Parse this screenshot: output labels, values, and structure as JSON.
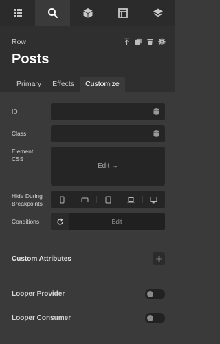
{
  "topbar": {
    "tabs": [
      {
        "icon": "list-icon",
        "active": false
      },
      {
        "icon": "search-icon",
        "active": true
      },
      {
        "icon": "box-icon",
        "active": false
      },
      {
        "icon": "layout-icon",
        "active": false
      },
      {
        "icon": "layers-icon",
        "active": false
      }
    ]
  },
  "header": {
    "breadcrumb": "Row",
    "title": "Posts",
    "icons": [
      "move-up-icon",
      "duplicate-icon",
      "delete-icon",
      "settings-icon"
    ]
  },
  "tabs": [
    {
      "label": "Primary",
      "active": false
    },
    {
      "label": "Effects",
      "active": false
    },
    {
      "label": "Customize",
      "active": true
    }
  ],
  "fields": {
    "id_label": "ID",
    "id_value": "",
    "class_label": "Class",
    "class_value": "",
    "element_css_label": "Element\nCSS",
    "element_css_button": "Edit →",
    "hide_label": "Hide During\nBreakpoints",
    "breakpoints": [
      "mobile-portrait-icon",
      "mobile-landscape-icon",
      "tablet-icon",
      "laptop-icon",
      "desktop-icon"
    ],
    "conditions_label": "Conditions",
    "conditions_button": "Edit"
  },
  "sections": {
    "custom_attributes": "Custom Attributes",
    "looper_provider": "Looper Provider",
    "looper_consumer": "Looper Consumer"
  },
  "toggles": {
    "looper_provider": false,
    "looper_consumer": false
  },
  "colors": {
    "background": "#3a3a3a",
    "header": "#2f2f2f",
    "field": "#252525"
  }
}
